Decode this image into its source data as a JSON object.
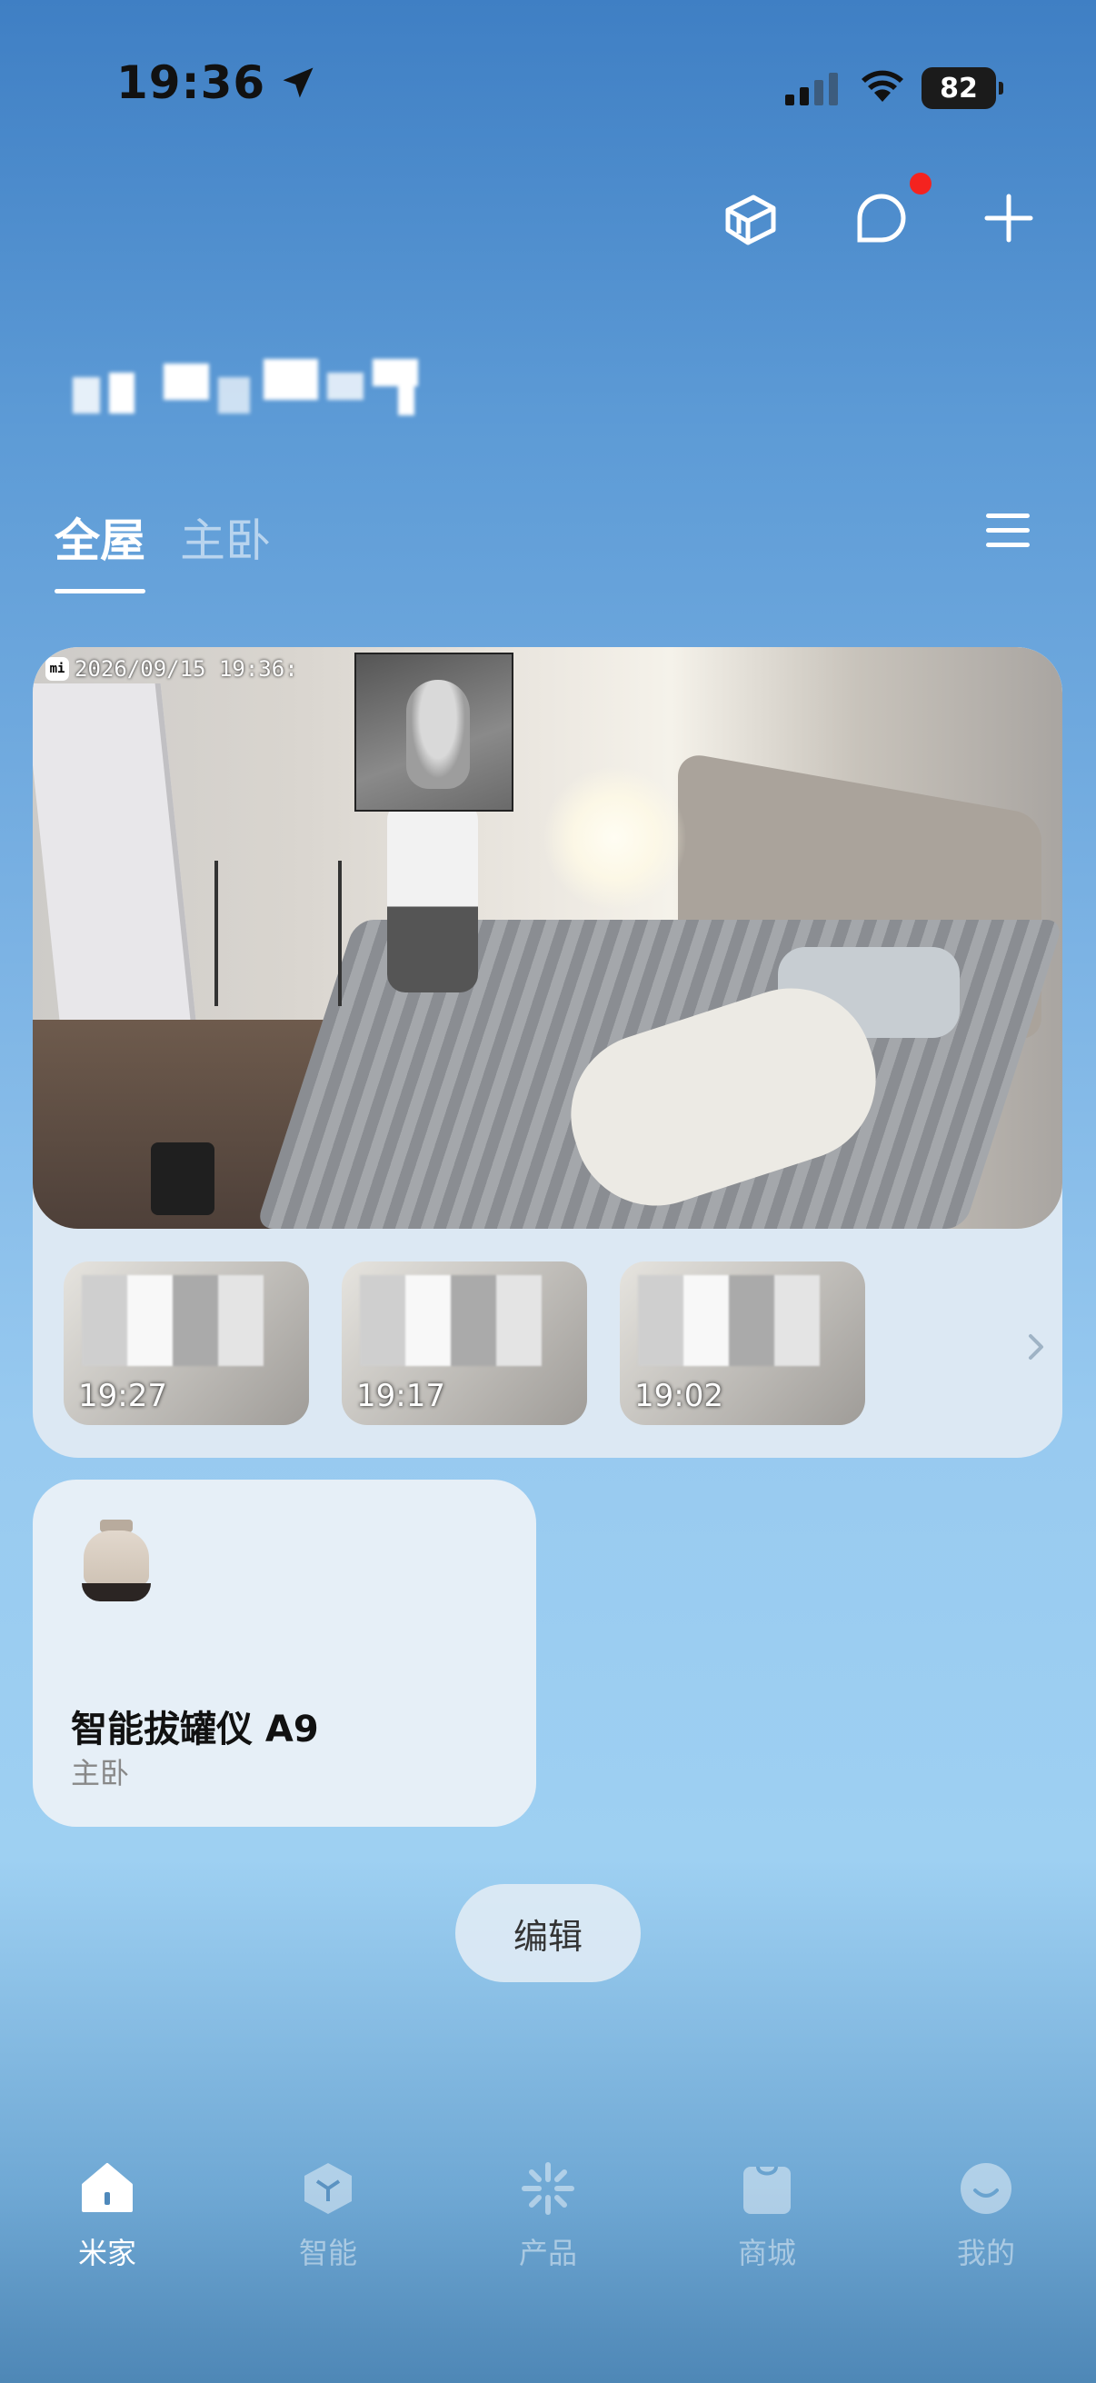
{
  "status_bar": {
    "time": "19:36",
    "battery": "82"
  },
  "tabs": [
    {
      "label": "全屋",
      "active": true
    },
    {
      "label": "主卧",
      "active": false
    }
  ],
  "camera": {
    "timestamp": "2026/09/15 19:36:",
    "events": [
      {
        "time": "19:27"
      },
      {
        "time": "19:17"
      },
      {
        "time": "19:02"
      }
    ]
  },
  "device": {
    "name": "智能拔罐仪 A9",
    "room": "主卧"
  },
  "edit_label": "编辑",
  "bottom_nav": [
    {
      "label": "米家",
      "icon": "home-icon",
      "active": true
    },
    {
      "label": "智能",
      "icon": "smart-cube-icon",
      "active": false
    },
    {
      "label": "产品",
      "icon": "product-sparkle-icon",
      "active": false
    },
    {
      "label": "商城",
      "icon": "shopping-bag-icon",
      "active": false
    },
    {
      "label": "我的",
      "icon": "profile-smile-icon",
      "active": false
    }
  ],
  "colors": {
    "notification": "#f4231f",
    "accent": "#ffffff"
  }
}
